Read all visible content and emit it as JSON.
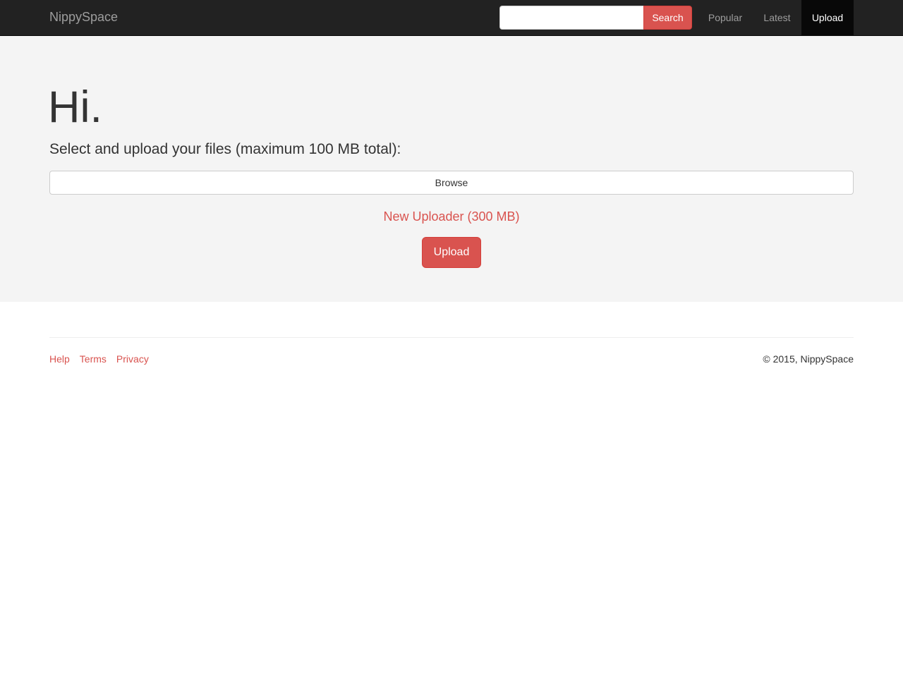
{
  "navbar": {
    "brand": "NippySpace",
    "search": {
      "value": "",
      "placeholder": "",
      "button_label": "Search"
    },
    "links": [
      {
        "label": "Popular",
        "active": false
      },
      {
        "label": "Latest",
        "active": false
      },
      {
        "label": "Upload",
        "active": true
      }
    ]
  },
  "main": {
    "title": "Hi.",
    "subtitle": "Select and upload your files (maximum 100 MB total):",
    "browse_label": "Browse",
    "new_uploader_link": "New Uploader (300 MB)",
    "upload_label": "Upload"
  },
  "footer": {
    "links": [
      {
        "label": "Help"
      },
      {
        "label": "Terms"
      },
      {
        "label": "Privacy"
      }
    ],
    "copyright": "© 2015, NippySpace"
  },
  "colors": {
    "accent": "#d9534f",
    "navbar_bg": "#222222",
    "active_nav_bg": "#080808",
    "jumbotron_bg": "#f4f4f4",
    "text": "#333333"
  }
}
